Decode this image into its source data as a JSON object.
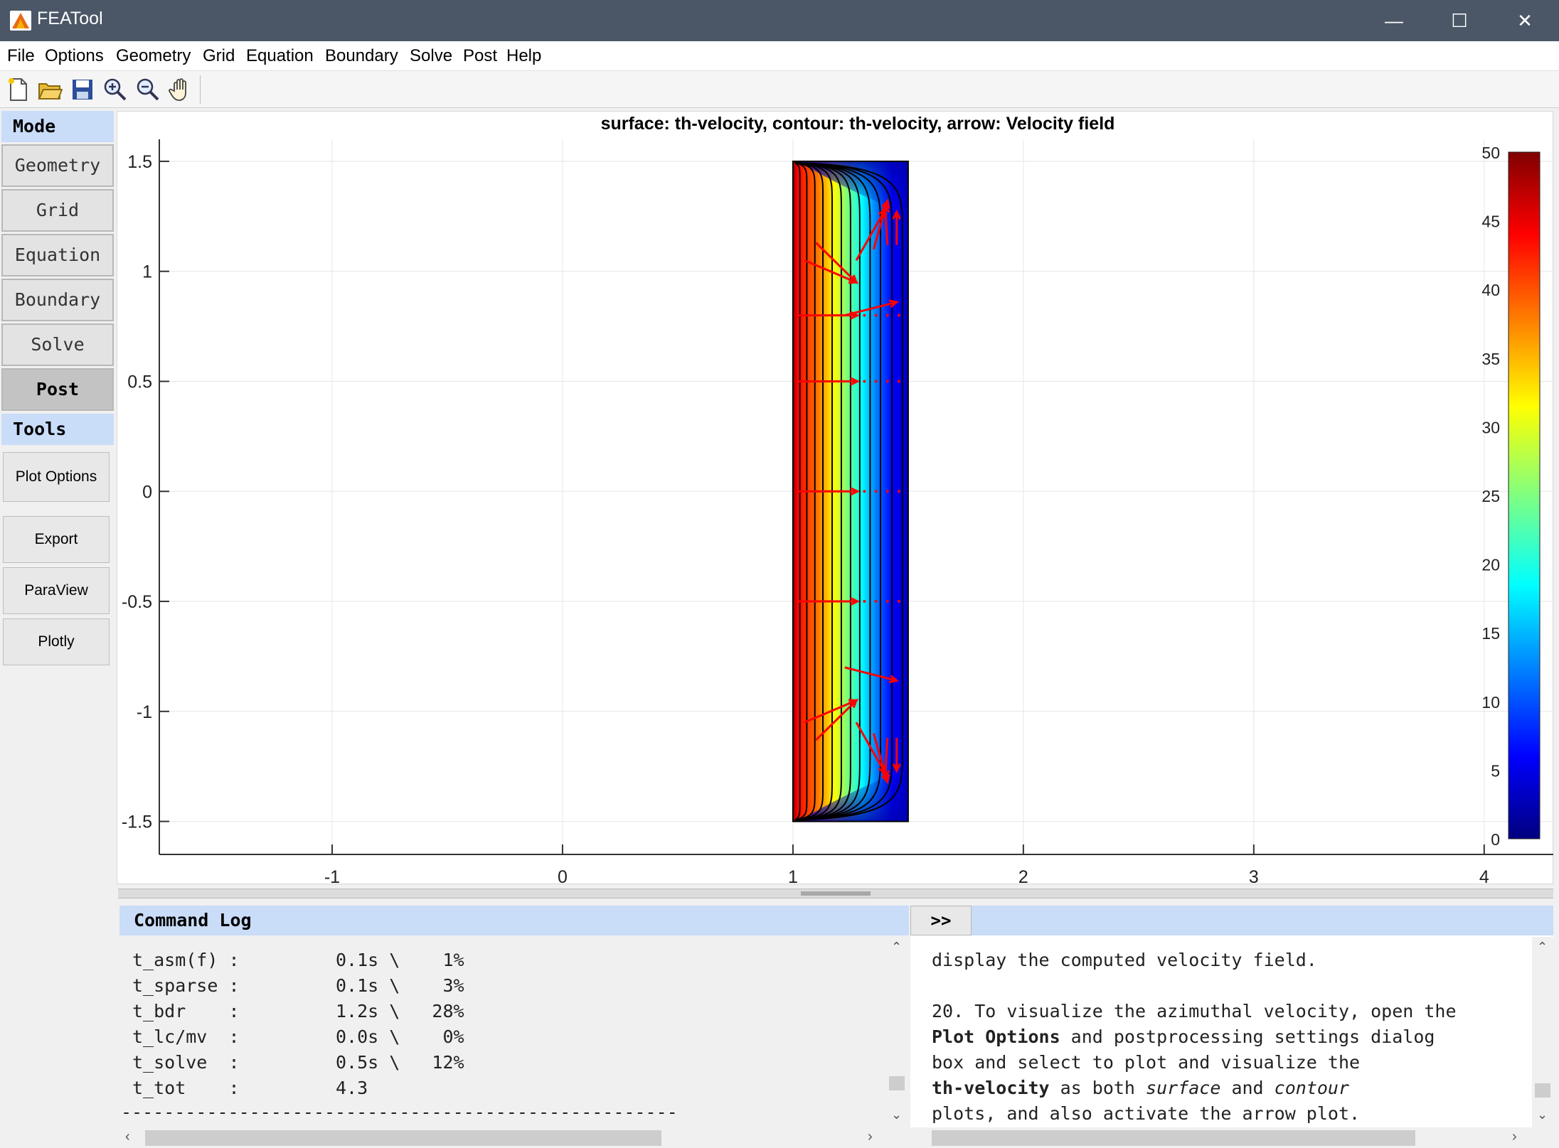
{
  "window": {
    "title": "FEATool",
    "controls": [
      "—",
      "☐",
      "✕"
    ]
  },
  "menu": [
    "File",
    "Options",
    "Geometry",
    "Grid",
    "Equation",
    "Boundary",
    "Solve",
    "Post",
    "Help"
  ],
  "toolbar_icons": [
    "new-file-icon",
    "open-folder-icon",
    "save-icon",
    "zoom-in-icon",
    "zoom-out-icon",
    "pan-hand-icon"
  ],
  "sidebar": {
    "mode_header": "Mode",
    "mode_buttons": [
      "Geometry",
      "Grid",
      "Equation",
      "Boundary",
      "Solve",
      "Post"
    ],
    "active_mode": "Post",
    "tools_header": "Tools",
    "tool_buttons": [
      "Plot Options",
      "Export",
      "ParaView",
      "Plotly"
    ]
  },
  "plot": {
    "title": "surface: th-velocity, contour: th-velocity, arrow: Velocity field",
    "x_ticks": [
      "-1",
      "0",
      "1",
      "2",
      "3",
      "4"
    ],
    "y_ticks": [
      "1.5",
      "1",
      "0.5",
      "0",
      "-0.5",
      "-1",
      "-1.5"
    ],
    "colorbar_ticks": [
      "50",
      "45",
      "40",
      "35",
      "30",
      "25",
      "20",
      "15",
      "10",
      "5",
      "0"
    ],
    "colormap": "jet",
    "domain": {
      "x": [
        1,
        1.5
      ],
      "y": [
        -1.5,
        1.5
      ]
    }
  },
  "chart_data": {
    "type": "heatmap",
    "title": "surface: th-velocity, contour: th-velocity, arrow: Velocity field",
    "xlim": [
      -1.75,
      4.3
    ],
    "ylim": [
      -1.65,
      1.6
    ],
    "x_ticks": [
      -1,
      0,
      1,
      2,
      3,
      4
    ],
    "y_ticks": [
      -1.5,
      -1,
      -0.5,
      0,
      0.5,
      1,
      1.5
    ],
    "colorbar_range": [
      0,
      50
    ],
    "grid": true,
    "field": "th-velocity",
    "domain_x": [
      1,
      1.5
    ],
    "domain_y": [
      -1.5,
      1.5
    ]
  },
  "command_log": {
    "header": "Command Log",
    "lines": [
      "t_asm(f) :         0.1s \\    1%",
      "t_sparse :         0.1s \\    3%",
      "t_bdr    :         1.2s \\   28%",
      "t_lc/mv  :         0.0s \\    0%",
      "t_solve  :         0.5s \\   12%",
      "t_tot    :         4.3",
      "----------------------------------------------------"
    ]
  },
  "tutorial": {
    "toggle": ">>",
    "line1": "display the computed velocity field.",
    "p2_a": "20. To visualize the azimuthal velocity, open the",
    "p2_b_bold": "Plot Options",
    "p2_b_rest": " and postprocessing settings dialog",
    "p2_c": "box and select to plot and visualize the",
    "p2_d_bold": "th-velocity",
    "p2_d_1": " as both ",
    "p2_d_it1": "surface",
    "p2_d_2": " and ",
    "p2_d_it2": "contour",
    "p2_e": "plots, and also activate the arrow plot."
  },
  "colors": {
    "titlebar": "#4b5766",
    "panel_header": "#c9dcf8",
    "arrow": "#ff0000"
  }
}
